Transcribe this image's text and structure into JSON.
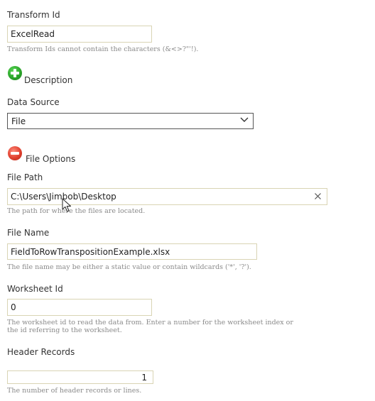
{
  "transform_id": {
    "label": "Transform Id",
    "value": "ExcelRead",
    "help": "Transform Ids cannot contain the characters (&<>?\"'!)."
  },
  "description": {
    "label": "Description",
    "toggle_icon": "plus-circle-icon",
    "toggle_color": "#2ca52a"
  },
  "data_source": {
    "label": "Data Source",
    "selected": "File",
    "icon": "chevron-down-icon"
  },
  "file_options": {
    "label": "File Options",
    "toggle_icon": "minus-circle-icon",
    "toggle_color": "#e0402f"
  },
  "file_path": {
    "label": "File Path",
    "value": "C:\\Users\\Jimbob\\Desktop",
    "help": "The path for where the files are located.",
    "clear_icon": "close-icon"
  },
  "file_name": {
    "label": "File Name",
    "value": "FieldToRowTranspositionExample.xlsx",
    "help": "The file name may be either a static value or contain wildcards ('*', '?')."
  },
  "worksheet_id": {
    "label": "Worksheet Id",
    "value": "0",
    "help_line1": "The worksheet id to read the data from. Enter a number for the worksheet index or",
    "help_line2": "the id referring to the worksheet."
  },
  "header_records": {
    "label": "Header Records",
    "value": "1",
    "help": "The number of header records or lines."
  },
  "cursor_icon": "mouse-pointer-icon"
}
